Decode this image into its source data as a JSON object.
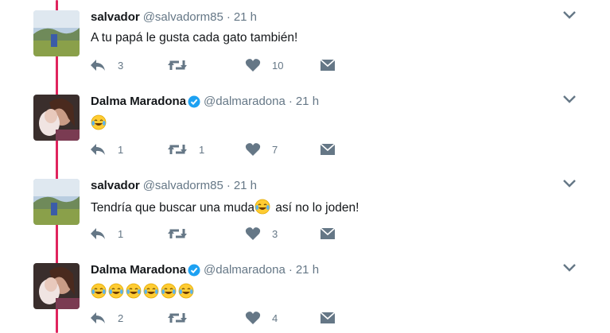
{
  "tweets": [
    {
      "name": "salvador",
      "handle": "@salvadorm85",
      "separator": "·",
      "time": "21 h",
      "verified": false,
      "avatar": "landscape-avatar",
      "text": "A tu papá le gusta cada gato también!",
      "emoji_count": 0,
      "replies": "3",
      "retweets": "",
      "likes": "10"
    },
    {
      "name": "Dalma Maradona",
      "handle": "@dalmaradona",
      "separator": "·",
      "time": "21 h",
      "verified": true,
      "avatar": "portrait-avatar",
      "text": "",
      "emoji_count": 1,
      "replies": "1",
      "retweets": "1",
      "likes": "7"
    },
    {
      "name": "salvador",
      "handle": "@salvadorm85",
      "separator": "·",
      "time": "21 h",
      "verified": false,
      "avatar": "landscape-avatar",
      "text_before": "Tendría que buscar una muda",
      "text_after": " así no lo joden!",
      "emoji_count": 1,
      "replies": "1",
      "retweets": "",
      "likes": "3"
    },
    {
      "name": "Dalma Maradona",
      "handle": "@dalmaradona",
      "separator": "·",
      "time": "21 h",
      "verified": true,
      "avatar": "portrait-avatar",
      "text": "",
      "emoji_count": 6,
      "replies": "2",
      "retweets": "",
      "likes": "4"
    }
  ],
  "icons": {
    "reply": "reply-icon",
    "retweet": "retweet-icon",
    "like": "heart-icon",
    "dm": "envelope-icon",
    "caret": "chevron-down-icon",
    "verified": "verified-badge-icon",
    "emoji": "face-with-tears-of-joy-emoji"
  },
  "colors": {
    "thread_line": "#e0245e",
    "icon": "#657786",
    "text": "#14171a",
    "verified": "#1da1f2"
  }
}
